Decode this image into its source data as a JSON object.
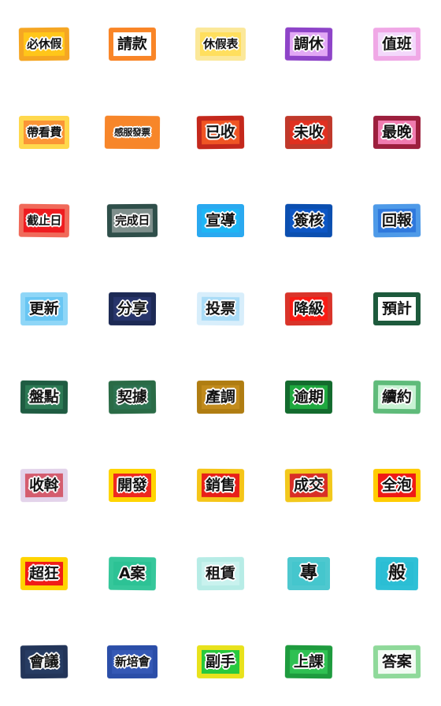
{
  "sheet": {
    "title": "Chinese work-label sticker sheet",
    "background": "#ffffff",
    "columns": 5,
    "rows": 8,
    "text_color": "#111111",
    "halo_color": "#ffffff"
  },
  "stickers": [
    {
      "text": "必休假",
      "border": "#f5a623",
      "fill": "#ffc61a",
      "halo": true
    },
    {
      "text": "請款",
      "border": "#f98527",
      "fill": "#ffffff",
      "halo": false
    },
    {
      "text": "休假表",
      "border": "#fbe89a",
      "fill": "#ffdf5e",
      "halo": true
    },
    {
      "text": "調休",
      "border": "#8e44c8",
      "fill": "#e2a8f5",
      "halo": true
    },
    {
      "text": "值班",
      "border": "#f0a8e6",
      "fill": "#f3d8fb",
      "halo": true
    },
    {
      "text": "帶看費",
      "border": "#ffd84d",
      "fill": "#fb9536",
      "halo": true
    },
    {
      "text": "感服發票",
      "border": "#f7862a",
      "fill": "#f7862a",
      "halo": true
    },
    {
      "text": "已收",
      "border": "#c4281c",
      "fill": "#ef5524",
      "halo": true
    },
    {
      "text": "未收",
      "border": "#c0392b",
      "fill": "#e03020",
      "halo": true
    },
    {
      "text": "最晚",
      "border": "#9c1f3d",
      "fill": "#f07cb0",
      "halo": true
    },
    {
      "text": "截止日",
      "border": "#f06a5a",
      "fill": "#ef1c20",
      "halo": true
    },
    {
      "text": "完成日",
      "border": "#2f4f4a",
      "fill": "#7f8f8c",
      "halo": true
    },
    {
      "text": "宣導",
      "border": "#2aa9f0",
      "fill": "#1fb6f5",
      "halo": true
    },
    {
      "text": "簽核",
      "border": "#0b4fb0",
      "fill": "#0d56c4",
      "halo": true
    },
    {
      "text": "回報",
      "border": "#4e9ae8",
      "fill": "#2f79dd",
      "halo": true
    },
    {
      "text": "更新",
      "border": "#8fd6f7",
      "fill": "#69c6f3",
      "halo": true
    },
    {
      "text": "分享",
      "border": "#1d2a55",
      "fill": "#28356b",
      "halo": true
    },
    {
      "text": "投票",
      "border": "#d8eefb",
      "fill": "#aadcf7",
      "halo": true
    },
    {
      "text": "降級",
      "border": "#d9342a",
      "fill": "#f81b14",
      "halo": true
    },
    {
      "text": "預計",
      "border": "#1d5a3c",
      "fill": "#ffffff",
      "halo": false
    },
    {
      "text": "盤點",
      "border": "#1f5c42",
      "fill": "#2d7a55",
      "halo": true
    },
    {
      "text": "契據",
      "border": "#2a6b46",
      "fill": "#2d7250",
      "halo": true
    },
    {
      "text": "產調",
      "border": "#b07d12",
      "fill": "#c18b1d",
      "halo": true
    },
    {
      "text": "逾期",
      "border": "#136b2e",
      "fill": "#1fa83f",
      "halo": true
    },
    {
      "text": "續約",
      "border": "#5fbb7a",
      "fill": "#c9f2d4",
      "halo": true
    },
    {
      "text": "收斡",
      "border": "#e3d3ea",
      "fill": "#d45d6e",
      "halo": true
    },
    {
      "text": "開發",
      "border": "#ffd400",
      "fill": "#ee2a20",
      "halo": true
    },
    {
      "text": "銷售",
      "border": "#f5c518",
      "fill": "#e8201a",
      "halo": true
    },
    {
      "text": "成交",
      "border": "#f2c81c",
      "fill": "#d92f27",
      "halo": true
    },
    {
      "text": "全泡",
      "border": "#ffcc00",
      "fill": "#ef1b16",
      "halo": true
    },
    {
      "text": "超狂",
      "border": "#ffd400",
      "fill": "#f01d18",
      "halo": true
    },
    {
      "text": "A案",
      "border": "#36c79b",
      "fill": "#2dc295",
      "halo": true
    },
    {
      "text": "租賃",
      "border": "#b7ece6",
      "fill": "#c9f2ee",
      "halo": true
    },
    {
      "text": "專",
      "border": "#4ec8cf",
      "fill": "#45c6cd",
      "halo": true
    },
    {
      "text": "般",
      "border": "#2fc0d6",
      "fill": "#2bbed4",
      "halo": true
    },
    {
      "text": "會議",
      "border": "#233559",
      "fill": "#273c63",
      "halo": true
    },
    {
      "text": "新培會",
      "border": "#2b4ea8",
      "fill": "#3558b5",
      "halo": true
    },
    {
      "text": "副手",
      "border": "#e8e21c",
      "fill": "#29c93e",
      "halo": true
    },
    {
      "text": "上課",
      "border": "#1e9b3e",
      "fill": "#2fc052",
      "halo": true
    },
    {
      "text": "答案",
      "border": "#8fd99a",
      "fill": "#f2fbf3",
      "halo": true
    }
  ]
}
